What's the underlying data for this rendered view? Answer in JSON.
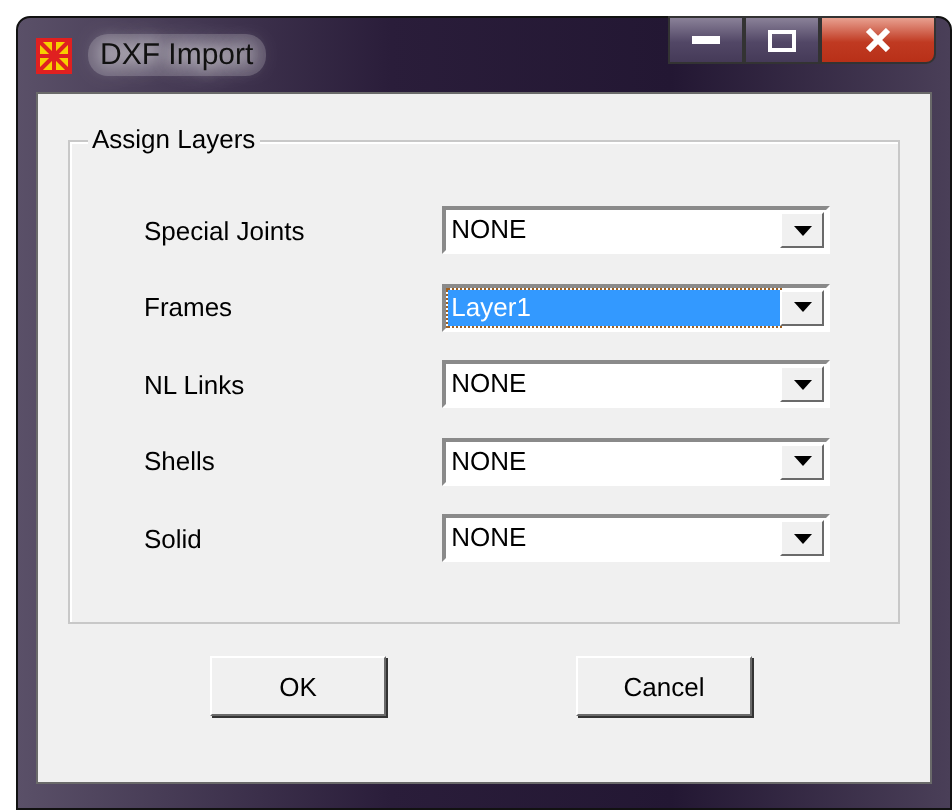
{
  "window": {
    "title": "DXF Import"
  },
  "group": {
    "title": "Assign Layers",
    "rows": [
      {
        "label": "Special Joints",
        "value": "NONE",
        "focused": false
      },
      {
        "label": "Frames",
        "value": "Layer1",
        "focused": true
      },
      {
        "label": "NL Links",
        "value": "NONE",
        "focused": false
      },
      {
        "label": "Shells",
        "value": "NONE",
        "focused": false
      },
      {
        "label": "Solid",
        "value": "NONE",
        "focused": false
      }
    ]
  },
  "buttons": [
    "OK",
    "Cancel"
  ]
}
